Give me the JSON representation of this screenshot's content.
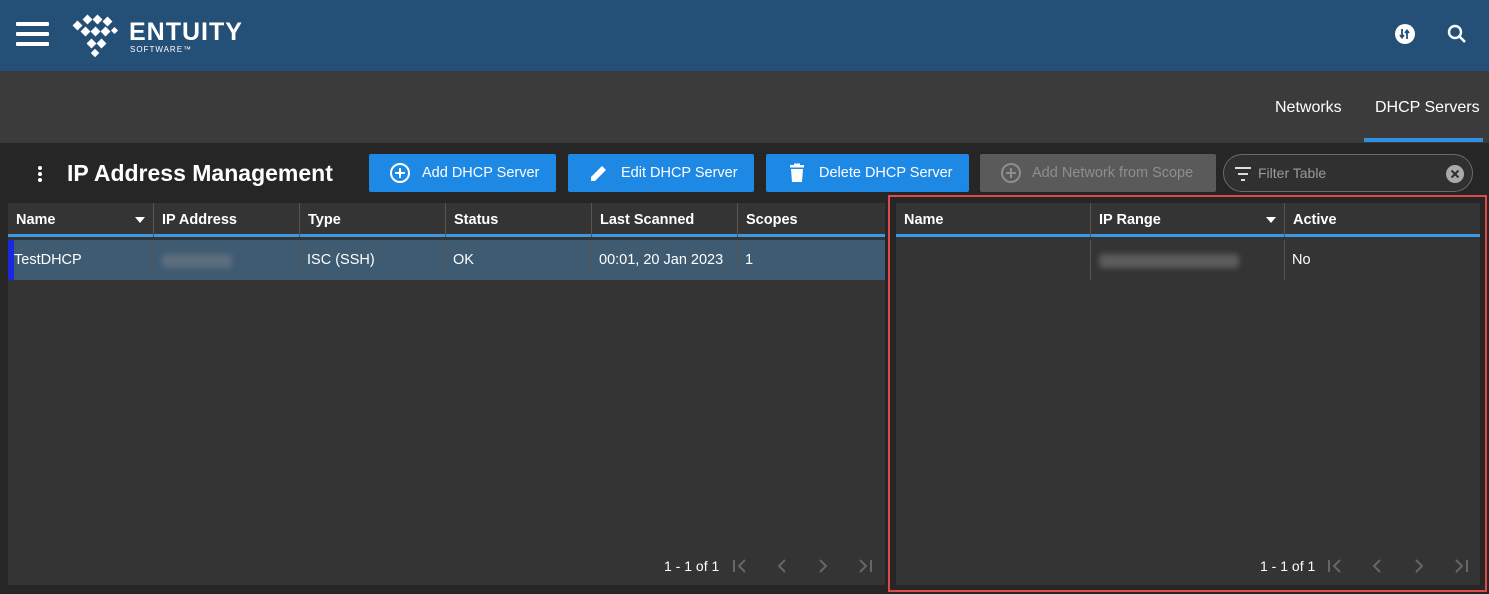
{
  "app": {
    "brand_name": "ENTUITY",
    "brand_sub": "SOFTWARE™",
    "icons": [
      "menu-icon",
      "swap-icon",
      "search-icon"
    ]
  },
  "tabs": [
    {
      "label": "Networks",
      "active": false
    },
    {
      "label": "DHCP Servers",
      "active": true
    }
  ],
  "toolbar": {
    "title": "IP Address Management",
    "add_server": "Add DHCP Server",
    "edit_server": "Edit DHCP Server",
    "delete_server": "Delete DHCP Server",
    "add_network": "Add Network from Scope",
    "filter_placeholder": "Filter Table"
  },
  "servers_table": {
    "columns": [
      "Name",
      "IP Address",
      "Type",
      "Status",
      "Last Scanned",
      "Scopes"
    ],
    "rows": [
      {
        "name": "TestDHCP",
        "ip": "",
        "type": "ISC (SSH)",
        "status": "OK",
        "last_scanned": "00:01, 20 Jan 2023",
        "scopes": "1"
      }
    ],
    "pager": "1 - 1 of 1"
  },
  "scopes_table": {
    "columns": [
      "Name",
      "IP Range",
      "Active"
    ],
    "rows": [
      {
        "name": "",
        "ip_range": "",
        "active": "No"
      }
    ],
    "pager": "1 - 1 of 1"
  },
  "colors": {
    "header_bg": "#245077",
    "accent": "#1e88e5",
    "selected_row": "#3e5b72",
    "highlight_border": "#e04a4a"
  }
}
